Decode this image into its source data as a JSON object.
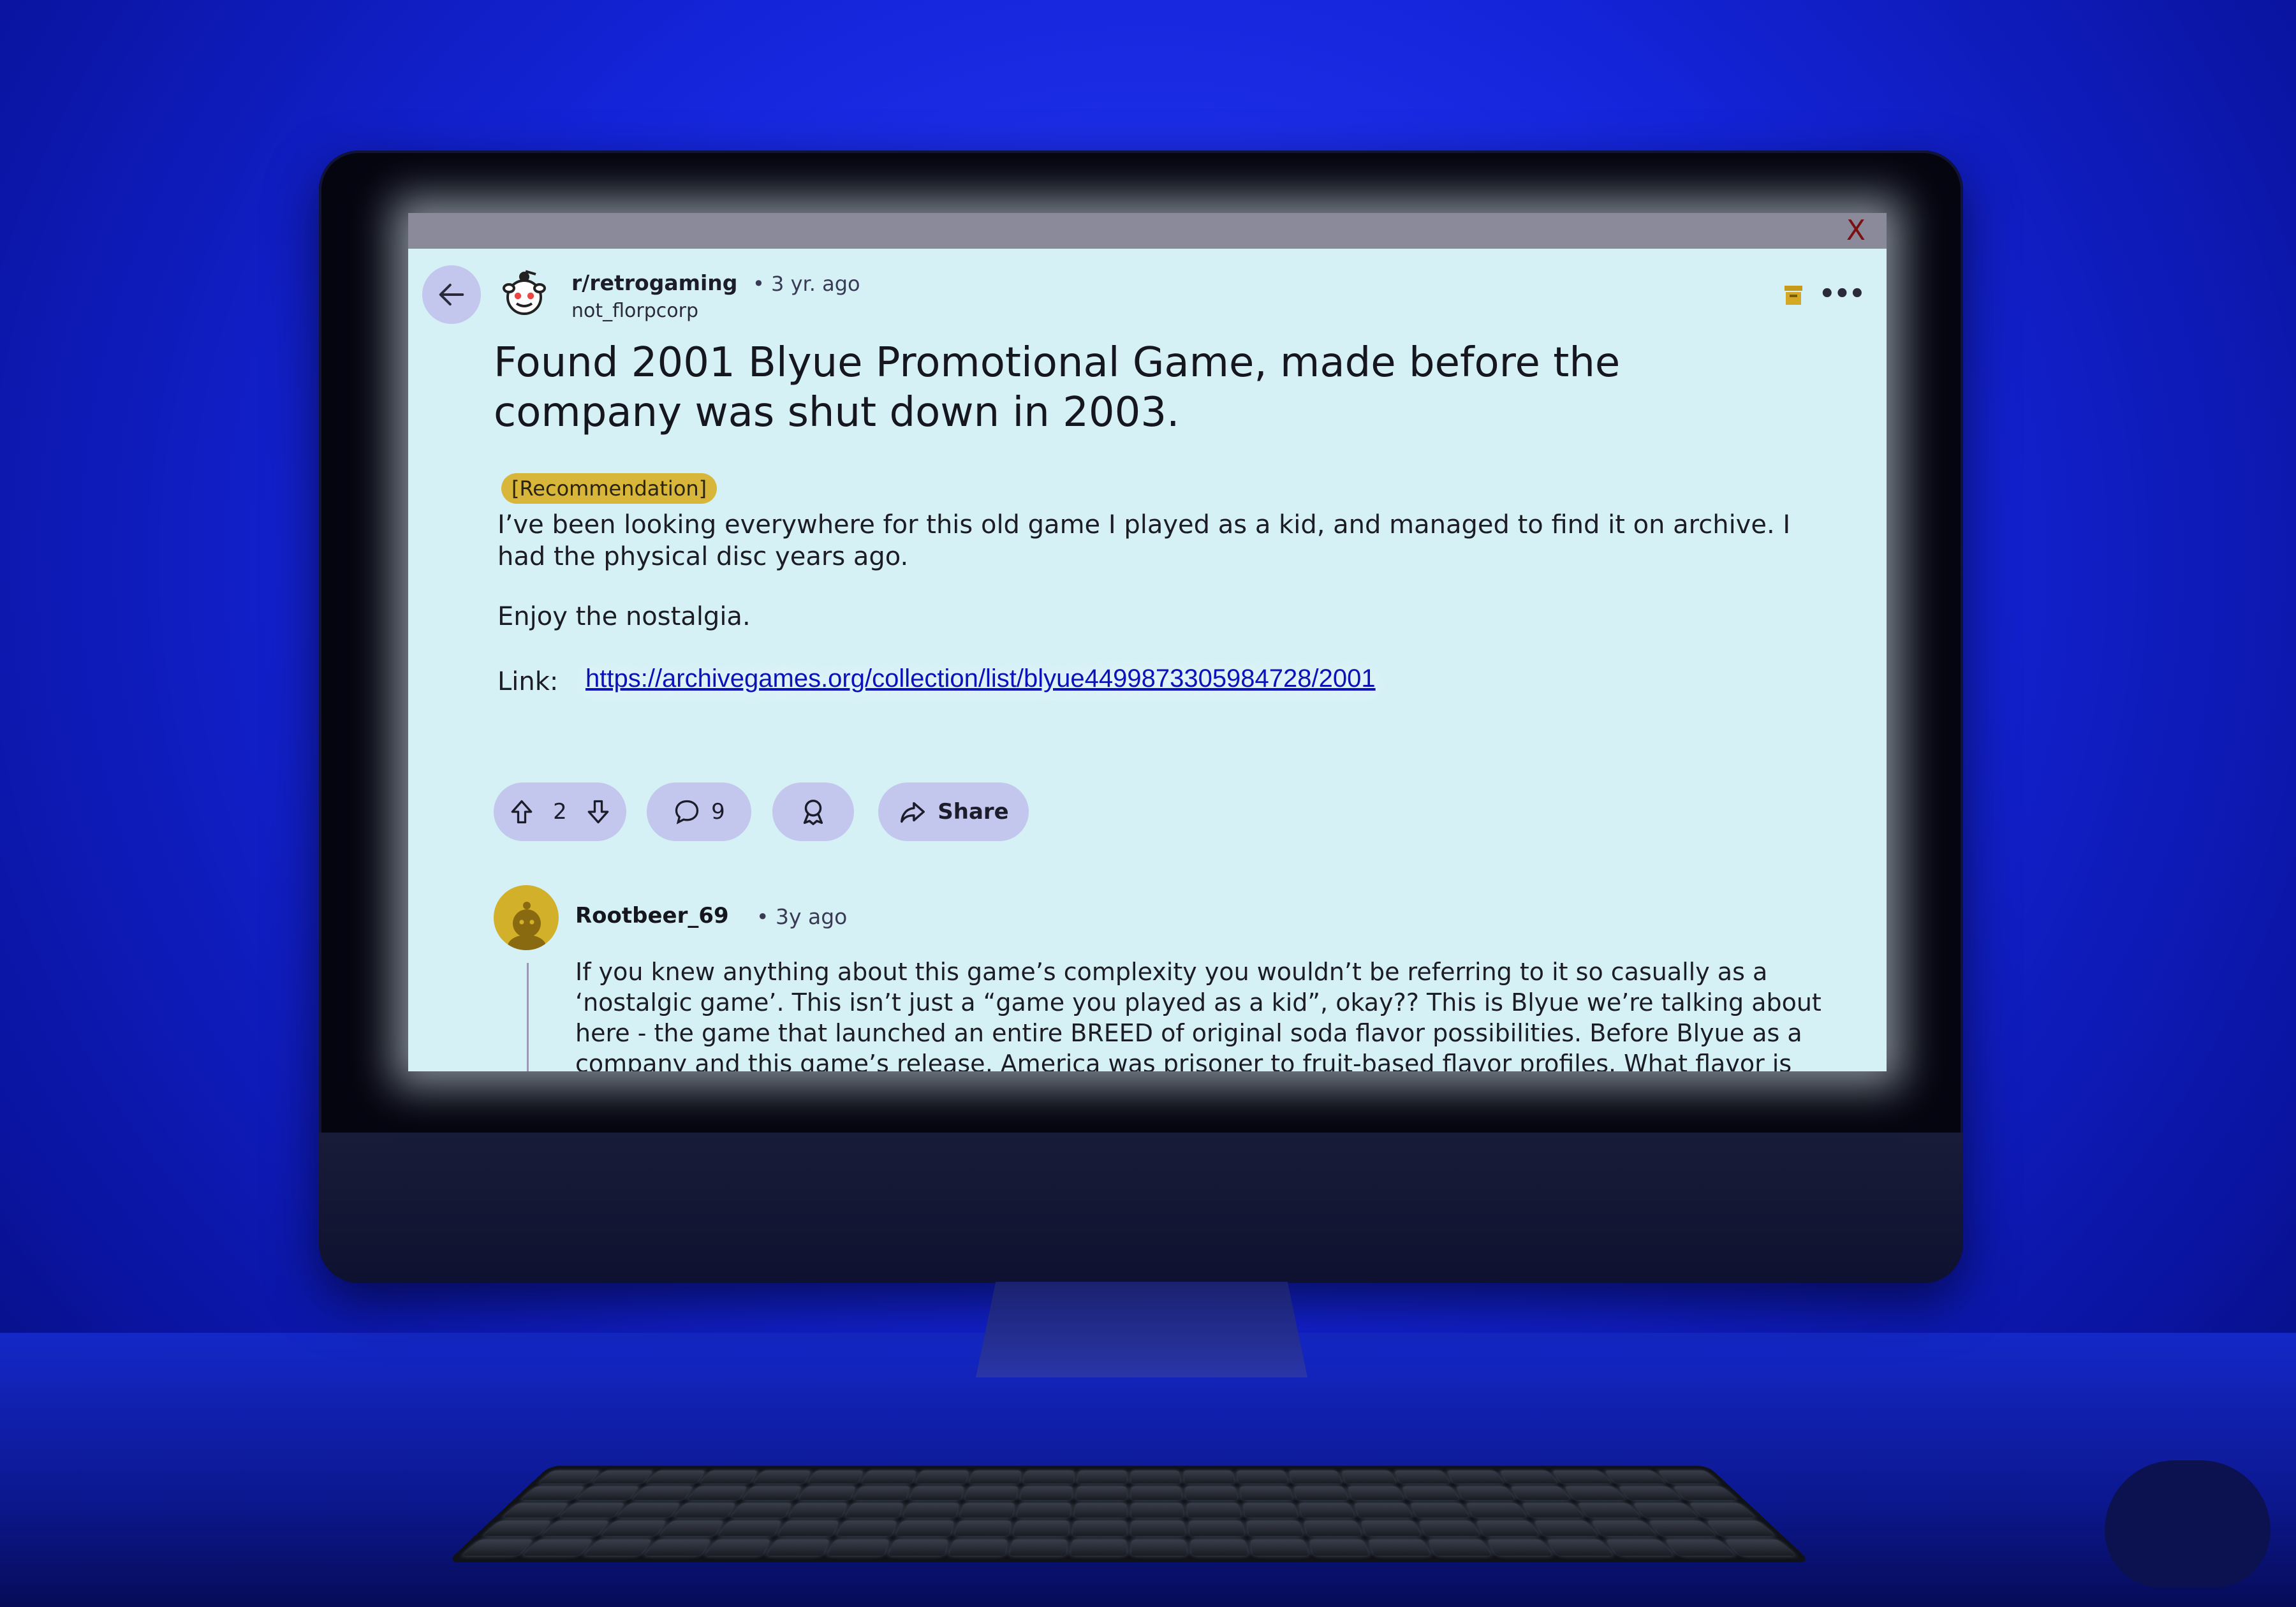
{
  "post": {
    "subreddit": "r/retrogaming",
    "age": "• 3 yr. ago",
    "author": "not_florpcorp",
    "title": "Found 2001 Blyue Promotional Game, made before the company was shut down in 2003.",
    "flair": "[Recommendation]",
    "body": "I’ve been looking everywhere for this old game I played as a kid, and managed to find it on archive. I had the physical disc years ago.",
    "closing": "Enjoy the nostalgia.",
    "link_label": "Link:",
    "link_url": "https://archivegames.org/collection/list/blyue4499873305984728/2001"
  },
  "actions": {
    "vote_count": "2",
    "comment_count": "9",
    "share_label": "Share"
  },
  "comment": {
    "author": "Rootbeer_69",
    "age": "• 3y ago",
    "body": "If you knew anything about this game’s complexity you wouldn’t be referring to it so casually as a ‘nostalgic game’. This isn’t just a “game you played as a kid”, okay?? This is Blyue we’re talking about here - the game that launched an entire BREED of original soda flavor possibilities. Before Blyue as a company and this game’s release, America was prisoner to fruit-based flavor profiles. What flavor is"
  },
  "window": {
    "close_glyph": "X"
  },
  "colors": {
    "screen_bg": "#d5f1f6",
    "pill_bg": "#c3c7ee",
    "flair_bg": "#d8b63a",
    "link": "#0a12b8",
    "backlight": "#1424d8"
  },
  "icons": [
    "back-arrow-icon",
    "subreddit-avatar-icon",
    "archive-icon",
    "more-icon",
    "upvote-icon",
    "downvote-icon",
    "comment-icon",
    "award-icon",
    "share-icon",
    "user-avatar-icon"
  ]
}
